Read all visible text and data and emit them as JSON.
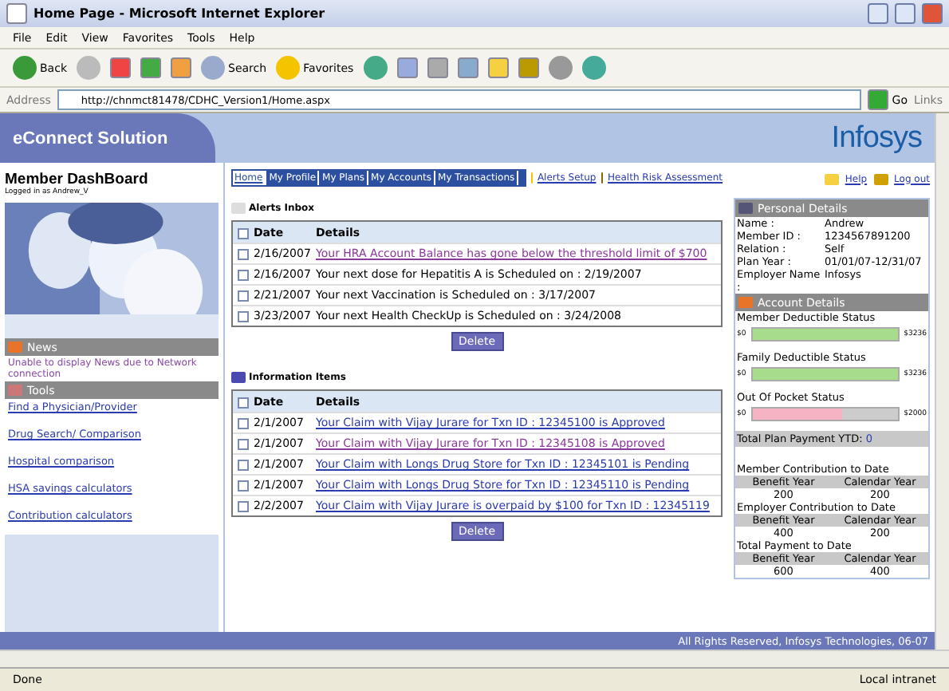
{
  "window": {
    "title": "Home Page - Microsoft Internet Explorer"
  },
  "menu": [
    "File",
    "Edit",
    "View",
    "Favorites",
    "Tools",
    "Help"
  ],
  "toolbar": {
    "back": "Back",
    "search": "Search",
    "favorites": "Favorites"
  },
  "address": {
    "label": "Address",
    "url": "http://chnmct81478/CDHC_Version1/Home.aspx",
    "go": "Go",
    "links": "Links"
  },
  "header": {
    "brand": "eConnect Solution",
    "logo": "Infosys"
  },
  "sidebar": {
    "title": "Member DashBoard",
    "logged_in": "Logged in as Andrew_V",
    "photo": {
      "kind": "picture"
    },
    "news_heading": "News",
    "news_text": "Unable to display News due to Network connection",
    "tools_heading": "Tools",
    "tools": [
      "Find a Physician/Provider",
      "Drug Search/ Comparison",
      "Hospital comparison",
      "HSA savings calculators",
      "Contribution calculators"
    ]
  },
  "nav_tabs": [
    {
      "label": "Home",
      "selected": true
    },
    {
      "label": "My Profile",
      "selected": false
    },
    {
      "label": "My Plans",
      "selected": false
    },
    {
      "label": "My Accounts",
      "selected": false
    },
    {
      "label": "My Transactions",
      "selected": false
    }
  ],
  "top_links": [
    "Alerts Setup",
    "Health Risk Assessment",
    "Help",
    "Log out"
  ],
  "alerts": {
    "title": "Alerts Inbox",
    "all_checked": false,
    "columns": [
      "Date",
      "Details"
    ],
    "delete": "Delete",
    "rows": [
      {
        "date": "2/16/2007",
        "details": "Your HRA Account Balance has gone below the threshold limit of $700",
        "checked": false,
        "kind": "link",
        "visited": true
      },
      {
        "date": "2/16/2007",
        "details": "Your next dose for Hepatitis A is Scheduled on : 2/19/2007",
        "checked": false,
        "kind": "text"
      },
      {
        "date": "2/21/2007",
        "details": "Your next Vaccination is Scheduled on : 3/17/2007",
        "checked": false,
        "kind": "text"
      },
      {
        "date": "3/23/2007",
        "details": "Your next Health CheckUp is Scheduled on : 3/24/2008",
        "checked": false,
        "kind": "text"
      }
    ]
  },
  "info": {
    "title": "Information Items",
    "all_checked": false,
    "columns": [
      "Date",
      "Details"
    ],
    "delete": "Delete",
    "rows": [
      {
        "date": "2/1/2007",
        "details": "Your Claim with Vijay Jurare for Txn ID : 12345100 is Approved",
        "checked": false,
        "kind": "link",
        "visited": false
      },
      {
        "date": "2/1/2007",
        "details": "Your Claim with Vijay Jurare for Txn ID : 12345108 is Approved",
        "checked": false,
        "kind": "link",
        "visited": true
      },
      {
        "date": "2/1/2007",
        "details": "Your Claim with Longs Drug Store for Txn ID : 12345101 is Pending",
        "checked": false,
        "kind": "link",
        "visited": false
      },
      {
        "date": "2/1/2007",
        "details": "Your Claim with Longs Drug Store for Txn ID : 12345110 is Pending",
        "checked": false,
        "kind": "link",
        "visited": false
      },
      {
        "date": "2/2/2007",
        "details": "Your Claim with Vijay Jurare is overpaid by $100 for Txn ID : 12345119",
        "checked": false,
        "kind": "link",
        "visited": false
      }
    ]
  },
  "personal": {
    "title": "Personal Details",
    "fields": [
      {
        "label": "Name :",
        "value": "Andrew"
      },
      {
        "label": "Member ID :",
        "value": "1234567891200"
      },
      {
        "label": "Relation :",
        "value": "Self"
      },
      {
        "label": "Plan Year :",
        "value": "01/01/07-12/31/07"
      },
      {
        "label": "Employer Name :",
        "value": "Infosys"
      }
    ]
  },
  "account": {
    "title": "Account Details",
    "statuses": [
      {
        "label": "Member Deductible Status",
        "min": "$0",
        "max": "$3236",
        "level": 1,
        "color": "#a6dc8c"
      },
      {
        "label": "Family Deductible Status",
        "min": "$0",
        "max": "$3236",
        "level": 1,
        "color": "#a6dc8c"
      },
      {
        "label": "Out Of Pocket Status",
        "min": "$0",
        "max": "$2000",
        "level": 0.62,
        "color": "#f4b4c4"
      }
    ],
    "total_label": "Total Plan Payment YTD:",
    "total_value": "0",
    "contributions": [
      {
        "title": "Member Contribution to Date",
        "columns": [
          "Benefit Year",
          "Calendar Year"
        ],
        "values": [
          "200",
          "200"
        ]
      },
      {
        "title": "Employer Contribution to Date",
        "columns": [
          "Benefit Year",
          "Calendar Year"
        ],
        "values": [
          "400",
          "200"
        ]
      },
      {
        "title": "Total Payment to Date",
        "columns": [
          "Benefit Year",
          "Calendar Year"
        ],
        "values": [
          "600",
          "400"
        ]
      }
    ]
  },
  "footer": "All Rights Reserved, Infosys Technologies, 06-07",
  "status_bar": {
    "text": "Done",
    "zone": "Local intranet"
  }
}
